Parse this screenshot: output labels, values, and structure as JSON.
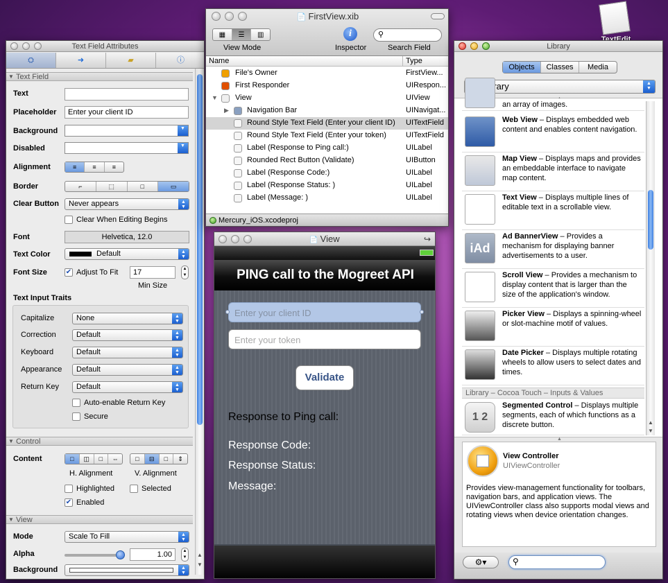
{
  "desktop": {
    "textedit_label": "TextEdit"
  },
  "attr_window": {
    "title": "Text Field Attributes",
    "section_textfield": "Text Field",
    "text_label": "Text",
    "text_value": "",
    "placeholder_label": "Placeholder",
    "placeholder_value": "Enter your client ID",
    "background_label": "Background",
    "disabled_label": "Disabled",
    "alignment_label": "Alignment",
    "border_label": "Border",
    "clear_button_label": "Clear Button",
    "clear_button_value": "Never appears",
    "clear_when_editing": "Clear When Editing Begins",
    "font_label": "Font",
    "font_value": "Helvetica, 12.0",
    "text_color_label": "Text Color",
    "text_color_value": "Default",
    "font_size_label": "Font Size",
    "adjust_to_fit": "Adjust To Fit",
    "min_size_value": "17",
    "min_size_label": "Min Size",
    "traits_header": "Text Input Traits",
    "capitalize_label": "Capitalize",
    "capitalize_value": "None",
    "correction_label": "Correction",
    "correction_value": "Default",
    "keyboard_label": "Keyboard",
    "keyboard_value": "Default",
    "appearance_label": "Appearance",
    "appearance_value": "Default",
    "return_key_label": "Return Key",
    "return_key_value": "Default",
    "auto_enable": "Auto-enable Return Key",
    "secure": "Secure",
    "section_control": "Control",
    "content_label": "Content",
    "h_alignment": "H. Alignment",
    "v_alignment": "V. Alignment",
    "highlighted": "Highlighted",
    "selected": "Selected",
    "enabled": "Enabled",
    "section_view": "View",
    "mode_label": "Mode",
    "mode_value": "Scale To Fill",
    "alpha_label": "Alpha",
    "alpha_value": "1.00",
    "alpha_level": 1.0,
    "view_background_label": "Background"
  },
  "xib_window": {
    "title": "FirstView.xib",
    "view_mode_label": "View Mode",
    "inspector_label": "Inspector",
    "search_field_label": "Search Field",
    "col_name": "Name",
    "col_type": "Type",
    "rows": [
      {
        "name": "File's Owner",
        "type": "FirstView..."
      },
      {
        "name": "First Responder",
        "type": "UIRespon..."
      },
      {
        "name": "View",
        "type": "UIView"
      },
      {
        "name": "Navigation Bar",
        "type": "UINavigat..."
      },
      {
        "name": "Round Style Text Field (Enter your client ID)",
        "type": "UITextField"
      },
      {
        "name": "Round Style Text Field (Enter your token)",
        "type": "UITextField"
      },
      {
        "name": "Label (Response to Ping call:)",
        "type": "UILabel"
      },
      {
        "name": "Rounded Rect Button (Validate)",
        "type": "UIButton"
      },
      {
        "name": "Label (Response Code:)",
        "type": "UILabel"
      },
      {
        "name": "Label (Response Status: )",
        "type": "UILabel"
      },
      {
        "name": "Label (Message: )",
        "type": "UILabel"
      }
    ],
    "status": "Mercury_iOS.xcodeproj"
  },
  "view_window": {
    "title": "View",
    "nav_title": "PING call to the Mogreet API",
    "client_placeholder": "Enter your client ID",
    "token_placeholder": "Enter your token",
    "validate": "Validate",
    "response_ping": "Response to Ping call:",
    "response_code": "Response Code:",
    "response_status": "Response Status:",
    "message": "Message:"
  },
  "library_window": {
    "title": "Library",
    "tabs": [
      "Objects",
      "Classes",
      "Media"
    ],
    "dropdown": "Library",
    "partial_text": "an array of images.",
    "items": [
      {
        "name": "Web View",
        "desc": " – Displays embedded web content and enables content navigation.",
        "icon": "compass-icon"
      },
      {
        "name": "Map View",
        "desc": " – Displays maps and provides an embeddable interface to navigate map content.",
        "icon": "map-icon"
      },
      {
        "name": "Text View",
        "desc": " – Displays multiple lines of editable text in a scrollable view.",
        "icon": "text-icon"
      },
      {
        "name": "Ad BannerView",
        "desc": " – Provides a mechanism for displaying banner advertisements to a user.",
        "icon": "iad-icon",
        "glyph": "iAd"
      },
      {
        "name": "Scroll View",
        "desc": " – Provides a mechanism to display content that is larger than the size of the application's window.",
        "icon": "scroll-icon"
      },
      {
        "name": "Picker View",
        "desc": " – Displays a spinning-wheel or slot-machine motif of values.",
        "icon": "picker-icon"
      },
      {
        "name": "Date Picker",
        "desc": " – Displays multiple rotating wheels to allow users to select dates and times.",
        "icon": "date-picker-icon"
      }
    ],
    "group_header": "Library – Cocoa Touch – Inputs & Values",
    "segmented": {
      "name": "Segmented Control",
      "desc": " – Displays multiple segments, each of which functions as a discrete button.",
      "glyph": "1 2"
    },
    "detail_title": "View Controller",
    "detail_class": "UIViewController",
    "detail_desc": "Provides view-management functionality for toolbars, navigation bars, and application views. The UIViewController class also supports modal views and rotating views when device orientation changes."
  }
}
